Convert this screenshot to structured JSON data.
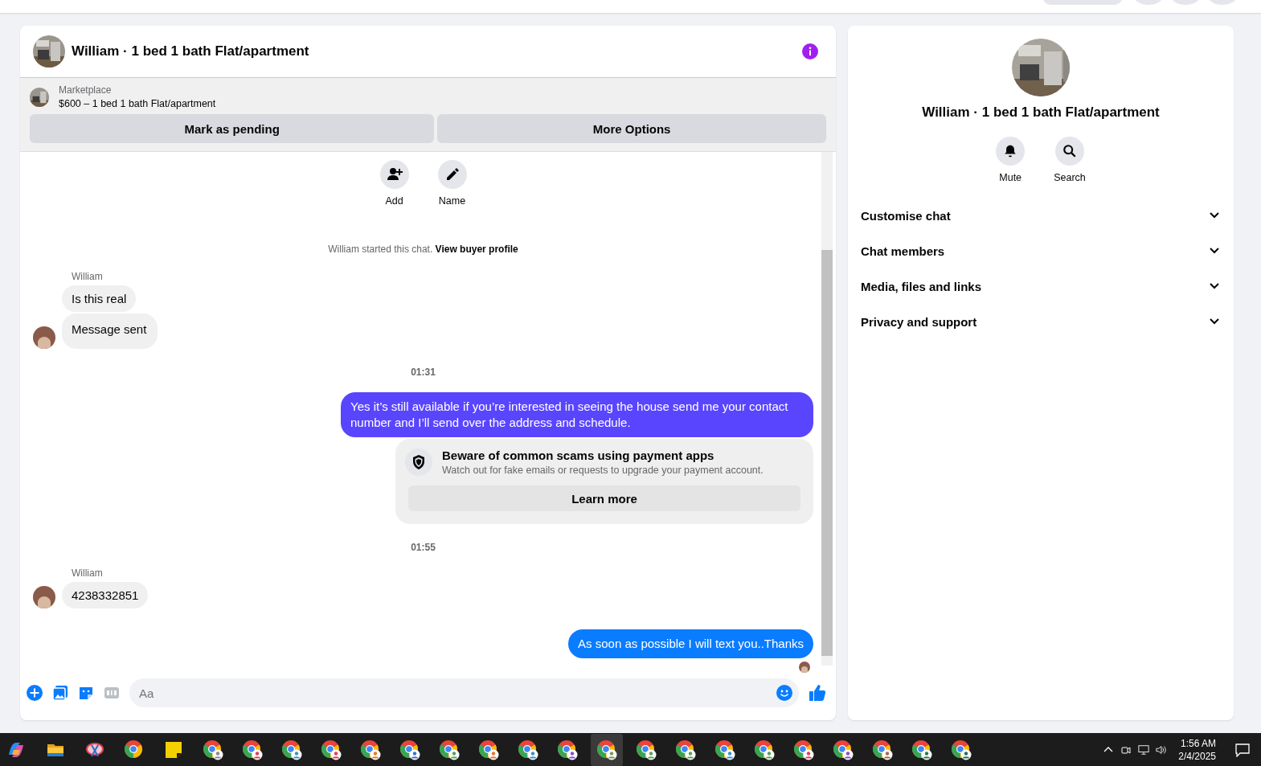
{
  "header": {
    "title": "William · 1 bed 1 bath Flat/apartment"
  },
  "listing": {
    "label": "Marketplace",
    "title": "$600 – 1 bed 1 bath Flat/apartment"
  },
  "actions": [
    "Mark as pending",
    "More Options"
  ],
  "quick_actions": [
    {
      "label": "Add"
    },
    {
      "label": "Name"
    }
  ],
  "messages": [
    {
      "kind": "system",
      "text": "William started this chat. **View buyer profile**"
    },
    {
      "kind": "incoming",
      "sender": "William",
      "bubbles": [
        "Is this real",
        "Message sent"
      ]
    },
    {
      "kind": "time",
      "text": "01:31"
    },
    {
      "kind": "outgoing",
      "text": "Yes it’s still available if you’re interested in seeing the house send me your contact number and I’ll send over the address and schedule.",
      "color": "#5a45fe"
    },
    {
      "kind": "warning",
      "title": "Beware of common scams using payment apps",
      "body": "Watch out for fake emails or requests to upgrade your payment account.",
      "button": "Learn more"
    },
    {
      "kind": "time",
      "text": "01:55"
    },
    {
      "kind": "incoming",
      "sender": "William",
      "bubbles": [
        "4238332851"
      ]
    },
    {
      "kind": "outgoing",
      "text": "As soon as possible I will text you..Thanks",
      "color": "#0a7cff"
    },
    {
      "kind": "seen"
    }
  ],
  "composer": {
    "placeholder": "Aa"
  },
  "side": {
    "title": "William · 1 bed 1 bath Flat/apartment",
    "actions": [
      {
        "label": "Mute"
      },
      {
        "label": "Search"
      }
    ],
    "sections": [
      {
        "label": "Customise chat",
        "expanded": false
      },
      {
        "label": "Chat members",
        "expanded": false
      },
      {
        "label": "Media, files and links",
        "expanded": false
      },
      {
        "label": "Privacy and support",
        "expanded": false
      }
    ]
  },
  "taskbar": {
    "apps": [
      {
        "kind": "copilot",
        "selected": false
      },
      {
        "kind": "folder",
        "selected": false
      },
      {
        "kind": "snip",
        "selected": false
      },
      {
        "kind": "browser",
        "selected": false
      },
      {
        "kind": "notes",
        "selected": false
      },
      {
        "kind": "profile",
        "color": "#8a8a8a",
        "selected": false
      },
      {
        "kind": "profile",
        "color": "#e0405a",
        "selected": false
      },
      {
        "kind": "profile",
        "color": "#3a8fd0",
        "selected": false
      },
      {
        "kind": "profile",
        "color": "#e0405a",
        "selected": false
      },
      {
        "kind": "profile",
        "color": "#e07a30",
        "selected": false
      },
      {
        "kind": "profile",
        "color": "#3a6fd0",
        "selected": false
      },
      {
        "kind": "profile",
        "color": "#5aa05a",
        "selected": false
      },
      {
        "kind": "profile",
        "color": "#e07a30",
        "selected": false
      },
      {
        "kind": "profile",
        "color": "#3a8fd0",
        "selected": false
      },
      {
        "kind": "profile",
        "color": "#8a4fd0",
        "selected": false
      },
      {
        "kind": "profile",
        "color": "#7a9a5a",
        "selected": true
      },
      {
        "kind": "profile",
        "color": "#5aa05a",
        "selected": false
      },
      {
        "kind": "profile",
        "color": "#5aa05a",
        "selected": false
      },
      {
        "kind": "profile",
        "color": "#3a8fd0",
        "selected": false
      },
      {
        "kind": "profile",
        "color": "#5aa05a",
        "selected": false
      },
      {
        "kind": "profile",
        "color": "#e0405a",
        "selected": false
      },
      {
        "kind": "profile",
        "color": "#8a4fd0",
        "selected": false
      },
      {
        "kind": "profile",
        "color": "#a06a4a",
        "selected": false
      },
      {
        "kind": "profile",
        "color": "#2a7a4a",
        "selected": false
      },
      {
        "kind": "profile",
        "color": "#2a6a5a",
        "selected": false
      }
    ],
    "time": "1:56 AM",
    "date": "2/4/2025"
  }
}
